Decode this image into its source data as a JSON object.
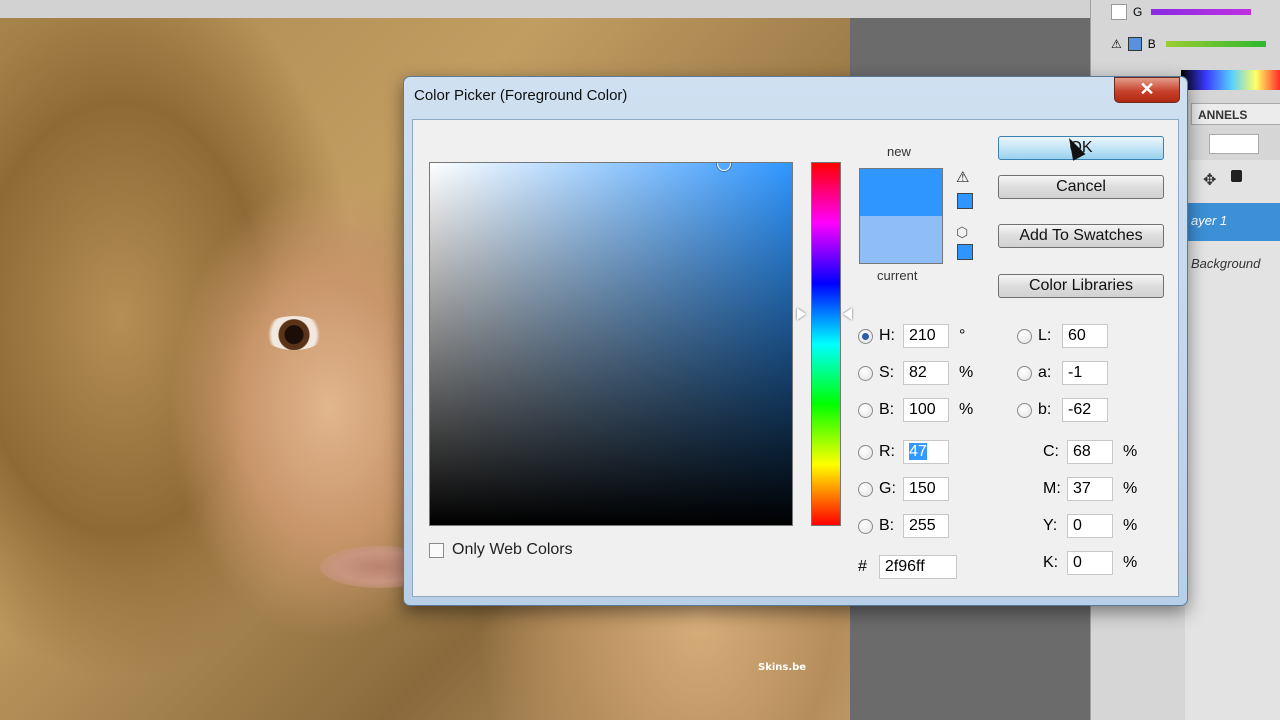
{
  "dialog": {
    "title": "Color Picker (Foreground Color)",
    "close_icon": "close-icon",
    "label_new": "new",
    "label_current": "current",
    "new_color": "#2f96ff",
    "current_color": "#8ebdf8",
    "buttons": {
      "ok": "OK",
      "cancel": "Cancel",
      "add_to_swatches": "Add To Swatches",
      "color_libraries": "Color Libraries"
    },
    "fields": {
      "h": {
        "label": "H:",
        "value": "210",
        "unit": "°",
        "selected": true
      },
      "s": {
        "label": "S:",
        "value": "82",
        "unit": "%"
      },
      "bright": {
        "label": "B:",
        "value": "100",
        "unit": "%"
      },
      "r": {
        "label": "R:",
        "value": "47"
      },
      "g": {
        "label": "G:",
        "value": "150"
      },
      "blue": {
        "label": "B:",
        "value": "255"
      },
      "l": {
        "label": "L:",
        "value": "60"
      },
      "a": {
        "label": "a:",
        "value": "-1"
      },
      "lab_b": {
        "label": "b:",
        "value": "-62"
      },
      "c": {
        "label": "C:",
        "value": "68",
        "unit": "%"
      },
      "m": {
        "label": "M:",
        "value": "37",
        "unit": "%"
      },
      "y": {
        "label": "Y:",
        "value": "0",
        "unit": "%"
      },
      "k": {
        "label": "K:",
        "value": "0",
        "unit": "%"
      }
    },
    "hex": {
      "label": "#",
      "value": "2f96ff"
    },
    "only_web_colors": {
      "label": "Only Web Colors",
      "checked": false
    },
    "icons": {
      "gamut_warning": "warning-triangle-icon",
      "web_safe": "cube-icon"
    }
  },
  "right_panel": {
    "channel_g": "G",
    "channel_b": "B",
    "tab_channels": "ANNELS",
    "layers": [
      "ayer 1",
      "Background"
    ]
  },
  "photo": {
    "watermark": "Skins.be"
  }
}
